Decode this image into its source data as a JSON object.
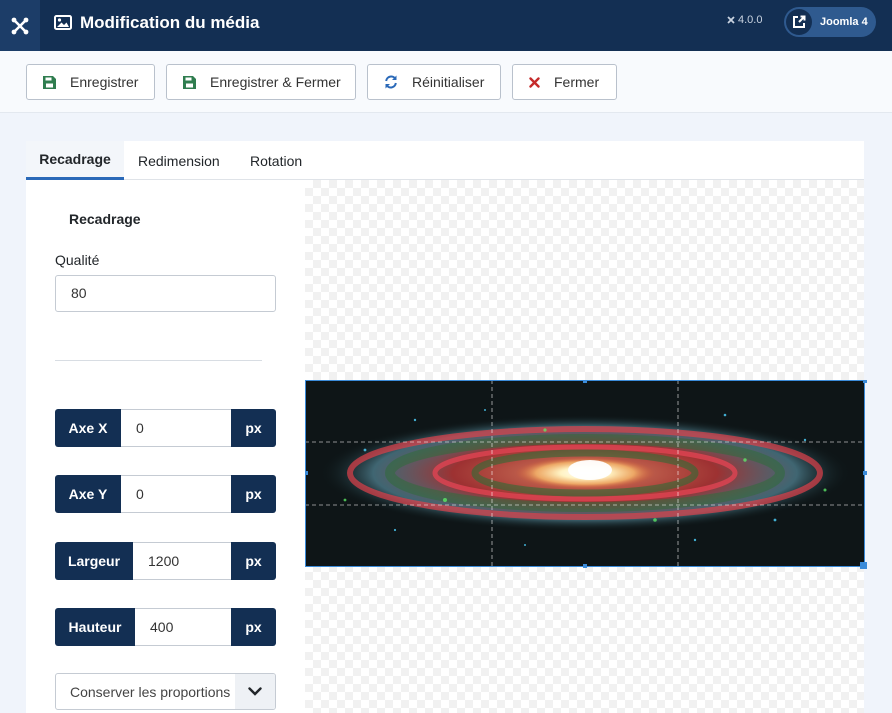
{
  "header": {
    "title": "Modification du média",
    "version": "4.0.0",
    "site_button_label": "Joomla 4"
  },
  "toolbar": {
    "save_label": "Enregistrer",
    "save_close_label": "Enregistrer & Fermer",
    "reset_label": "Réinitialiser",
    "close_label": "Fermer"
  },
  "tabs": [
    {
      "label": "Recadrage"
    },
    {
      "label": "Redimension"
    },
    {
      "label": "Rotation"
    }
  ],
  "crop": {
    "section_title": "Recadrage",
    "quality_label": "Qualité",
    "quality_value": "80",
    "x_label": "Axe X",
    "x_value": "0",
    "y_label": "Axe Y",
    "y_value": "0",
    "width_label": "Largeur",
    "width_value": "1200",
    "height_label": "Hauteur",
    "height_value": "400",
    "unit": "px",
    "ratio_option": "Conserver les proportions"
  },
  "colors": {
    "header_bg": "#132f53",
    "accent": "#2a69b8",
    "crop_border": "#3b8bd9"
  }
}
